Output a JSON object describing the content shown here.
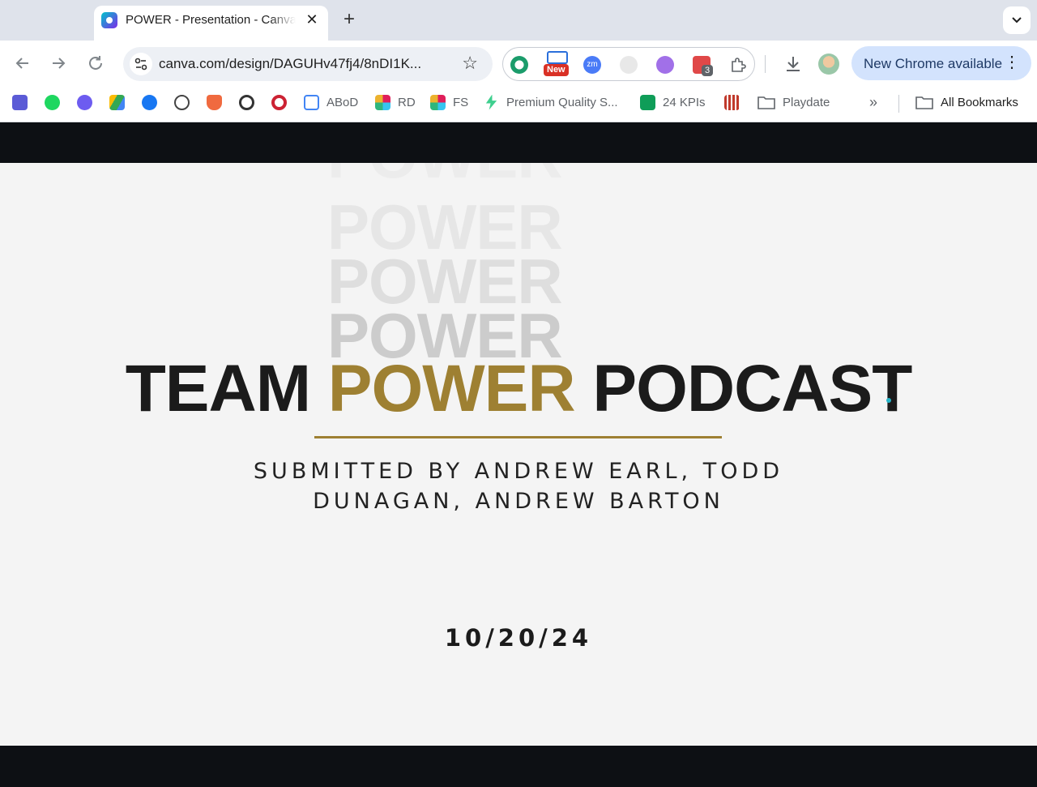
{
  "browser": {
    "tab": {
      "title": "POWER - Presentation - Canva",
      "close_glyph": "✕"
    },
    "new_tab_glyph": "+",
    "url": "canva.com/design/DAGUHv47fj4/8nDI1K...",
    "extensions": {
      "new_badge": "New",
      "zoom_label": "zm",
      "count_badge": "3"
    },
    "update_button": "New Chrome available",
    "menu_glyph": "⋮",
    "star_glyph": "☆"
  },
  "bookmarks": [
    {
      "label": "",
      "icon": "dashboard-icon",
      "color": "#5b5bd6"
    },
    {
      "label": "",
      "icon": "spotify-icon",
      "color": "#1ed760"
    },
    {
      "label": "",
      "icon": "asterisk-icon",
      "color": "#6d5cf0"
    },
    {
      "label": "",
      "icon": "drive-icon",
      "color": "#34a853"
    },
    {
      "label": "",
      "icon": "facebook-icon",
      "color": "#1877f2"
    },
    {
      "label": "",
      "icon": "openai-icon",
      "color": "#444444"
    },
    {
      "label": "",
      "icon": "shield-icon",
      "color": "#f06a3f"
    },
    {
      "label": "",
      "icon": "power-icon",
      "color": "#333333"
    },
    {
      "label": "",
      "icon": "opera-icon",
      "color": "#cc2233"
    },
    {
      "label": "ABoD",
      "icon": "calendar-icon",
      "color": "#4285f4"
    },
    {
      "label": "RD",
      "icon": "slack-icon",
      "color": "#e01e5a"
    },
    {
      "label": "FS",
      "icon": "slack-icon",
      "color": "#36c5f0"
    },
    {
      "label": "Premium Quality S...",
      "icon": "bolt-icon",
      "color": "#3ecf8e"
    },
    {
      "label": "24 KPIs",
      "icon": "sheets-icon",
      "color": "#0f9d58"
    },
    {
      "label": "",
      "icon": "grid-icon",
      "color": "#c0392b"
    },
    {
      "label": "Playdate",
      "icon": "folder-icon",
      "color": "#5f6368"
    }
  ],
  "bookmarks_overflow": "»",
  "all_bookmarks": "All Bookmarks",
  "slide": {
    "echo_word": "POWER",
    "title_part1": "TEAM ",
    "title_part2": "POWER",
    "title_part3": " PODCAST",
    "subtitle": "SUBMITTED BY ANDREW EARL, TODD DUNAGAN, ANDREW BARTON",
    "date": "10/20/24"
  },
  "colors": {
    "accent_gold": "#9e8032",
    "slide_bg": "#f4f4f4",
    "letterbox": "#0d1014"
  }
}
